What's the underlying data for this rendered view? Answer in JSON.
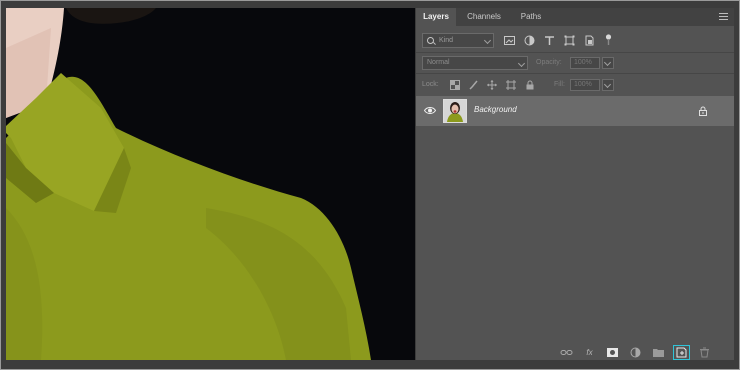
{
  "panel": {
    "tabs": [
      {
        "label": "Layers",
        "active": true
      },
      {
        "label": "Channels",
        "active": false
      },
      {
        "label": "Paths",
        "active": false
      }
    ],
    "filter": {
      "label": "Kind"
    },
    "blend_mode": "Normal",
    "opacity": {
      "label": "Opacity:",
      "value": "100%"
    },
    "lock": {
      "label": "Lock:"
    },
    "fill": {
      "label": "Fill:",
      "value": "100%"
    },
    "layers": [
      {
        "name": "Background",
        "visible": true,
        "locked": true
      }
    ],
    "bottom_icons": [
      "link-icon",
      "fx-icon",
      "mask-icon",
      "adjustment-icon",
      "folder-icon",
      "new-layer-icon",
      "trash-icon"
    ],
    "bottom_fx_label": "fx"
  },
  "colors": {
    "panel_bg": "#535353",
    "selected_layer": "#6b6b6b",
    "highlight": "#2fc4d8",
    "shirt": "#8c9a1d"
  }
}
